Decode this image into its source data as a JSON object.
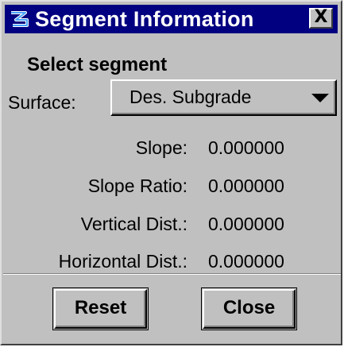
{
  "window": {
    "title": "Segment Information",
    "app_icon": "app-logo-icon",
    "close_glyph": "X"
  },
  "heading": "Select segment",
  "surface": {
    "label": "Surface:",
    "selected": "Des. Subgrade"
  },
  "rows": [
    {
      "label": "Slope:",
      "value": "0.000000"
    },
    {
      "label": "Slope Ratio:",
      "value": "0.000000"
    },
    {
      "label": "Vertical Dist.:",
      "value": "0.000000"
    },
    {
      "label": "Horizontal Dist.:",
      "value": "0.000000"
    }
  ],
  "buttons": {
    "reset": "Reset",
    "close": "Close"
  },
  "colors": {
    "titlebar": "#000080",
    "face": "#c0c0c0"
  }
}
